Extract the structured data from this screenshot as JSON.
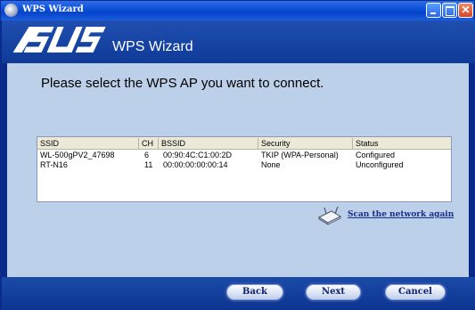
{
  "window": {
    "title": "WPS Wizard",
    "colors": {
      "titlebar": "#0a4ed6",
      "frame": "#0a2a8a",
      "content": "#bcd0e9",
      "link": "#1a2f8c"
    }
  },
  "header": {
    "logo": "/SUS",
    "title": "WPS Wizard"
  },
  "main": {
    "prompt": "Please select the WPS AP you want to connect.",
    "table": {
      "columns": [
        "SSID",
        "CH",
        "BSSID",
        "Security",
        "Status"
      ],
      "rows": [
        [
          "WL-500gPV2_47698",
          "6",
          "00:90:4C:C1:00:2D",
          "TKIP (WPA-Personal)",
          "Configured"
        ],
        [
          "RT-N16",
          "11",
          "00:00:00:00:00:14",
          "None",
          "Unconfigured"
        ]
      ]
    },
    "scan_link": "Scan the network again",
    "scan_icon": "router-icon"
  },
  "footer": {
    "back_label": "Back",
    "next_label": "Next",
    "cancel_label": "Cancel"
  }
}
